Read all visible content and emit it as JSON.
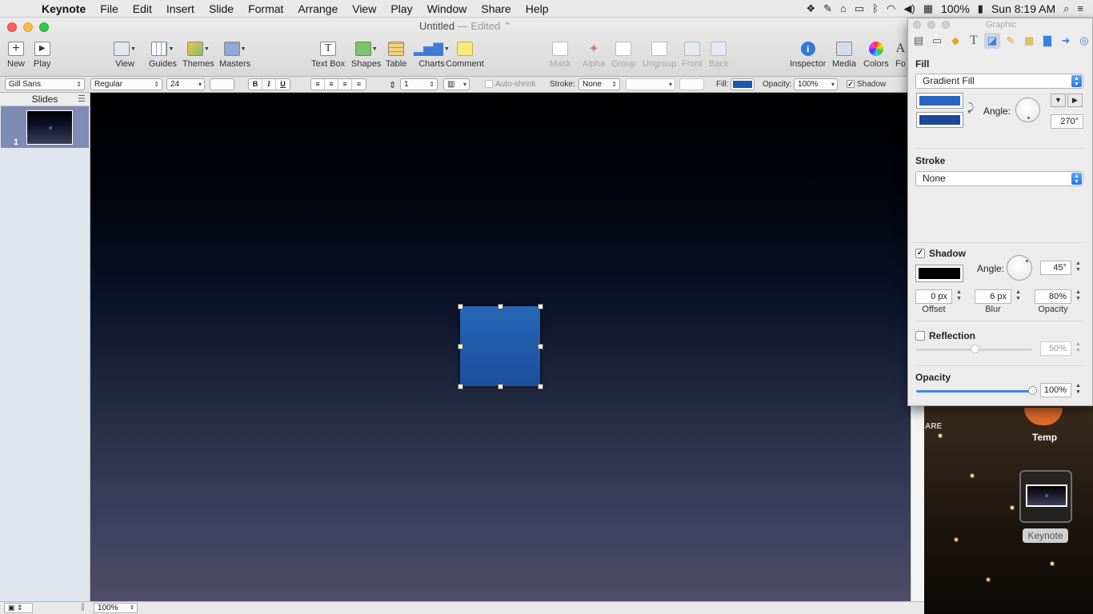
{
  "menubar": {
    "app": "Keynote",
    "items": [
      "File",
      "Edit",
      "Insert",
      "Slide",
      "Format",
      "Arrange",
      "View",
      "Play",
      "Window",
      "Share",
      "Help"
    ],
    "battery": "100%",
    "clock": "Sun 8:19 AM"
  },
  "window": {
    "title": "Untitled",
    "subtitle": "Edited"
  },
  "toolbar": {
    "new": "New",
    "play": "Play",
    "view": "View",
    "guides": "Guides",
    "themes": "Themes",
    "masters": "Masters",
    "textbox": "Text Box",
    "shapes": "Shapes",
    "table": "Table",
    "charts": "Charts",
    "comment": "Comment",
    "mask": "Mask",
    "alpha": "Alpha",
    "group": "Group",
    "ungroup": "Ungroup",
    "front": "Front",
    "back": "Back",
    "inspector": "Inspector",
    "media": "Media",
    "colors": "Colors",
    "fonts": "Fo"
  },
  "formatbar": {
    "font_family": "Gill Sans",
    "font_style": "Regular",
    "font_size": "24",
    "bold": "B",
    "italic": "I",
    "underline": "U",
    "line_spacing": "1",
    "autoshrink": "Auto-shrink",
    "stroke_label": "Stroke:",
    "stroke_value": "None",
    "fill_label": "Fill:",
    "fill_color": "#1d57b0",
    "opacity_label": "Opacity:",
    "opacity_value": "100%",
    "shadow": "Shadow"
  },
  "sidebar": {
    "header": "Slides",
    "slides": [
      {
        "number": "1"
      }
    ]
  },
  "footer": {
    "zoom": "100%"
  },
  "inspector": {
    "title": "Graphic",
    "fill": {
      "header": "Fill",
      "type": "Gradient Fill",
      "color1": "#2a66c0",
      "color2": "#1a4898",
      "angle_label": "Angle:",
      "angle": "270°"
    },
    "stroke": {
      "header": "Stroke",
      "type": "None"
    },
    "shadow": {
      "header": "Shadow",
      "checked": true,
      "color": "#000000",
      "angle_label": "Angle:",
      "angle": "45°",
      "offset": "0 px",
      "offset_label": "Offset",
      "blur": "6 px",
      "blur_label": "Blur",
      "opacity": "80%",
      "opacity_label": "Opacity"
    },
    "reflection": {
      "header": "Reflection",
      "checked": false,
      "value": "50%"
    },
    "opacity": {
      "header": "Opacity",
      "value": "100%",
      "level": 1.0
    }
  },
  "desktop": {
    "widget_label": "Temp",
    "dock_label": "Keynote",
    "side_text": "ARE"
  },
  "colors": {
    "accent": "#2870e8",
    "shape_fill": "#1f5aa8"
  }
}
